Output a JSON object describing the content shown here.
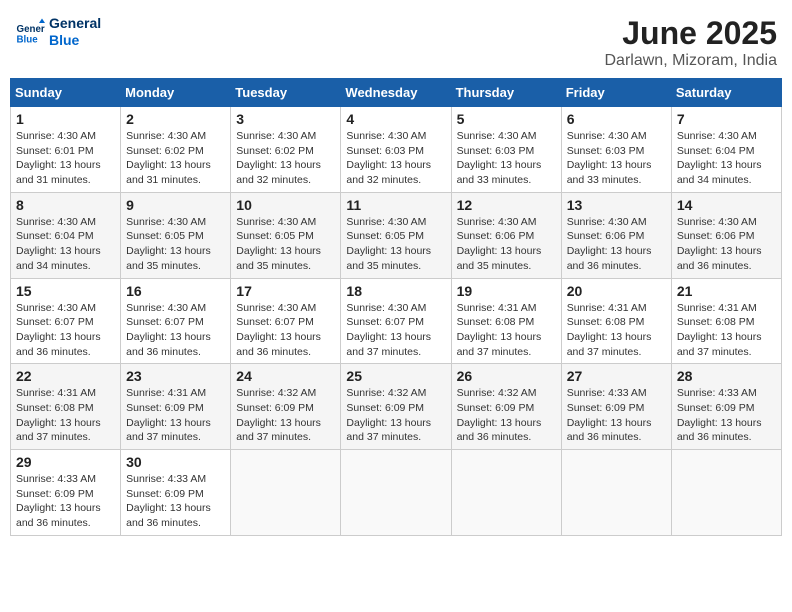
{
  "header": {
    "logo_line1": "General",
    "logo_line2": "Blue",
    "month_year": "June 2025",
    "location": "Darlawn, Mizoram, India"
  },
  "days_of_week": [
    "Sunday",
    "Monday",
    "Tuesday",
    "Wednesday",
    "Thursday",
    "Friday",
    "Saturday"
  ],
  "weeks": [
    [
      {
        "num": "1",
        "sunrise": "4:30 AM",
        "sunset": "6:01 PM",
        "daylight": "13 hours and 31 minutes."
      },
      {
        "num": "2",
        "sunrise": "4:30 AM",
        "sunset": "6:02 PM",
        "daylight": "13 hours and 31 minutes."
      },
      {
        "num": "3",
        "sunrise": "4:30 AM",
        "sunset": "6:02 PM",
        "daylight": "13 hours and 32 minutes."
      },
      {
        "num": "4",
        "sunrise": "4:30 AM",
        "sunset": "6:03 PM",
        "daylight": "13 hours and 32 minutes."
      },
      {
        "num": "5",
        "sunrise": "4:30 AM",
        "sunset": "6:03 PM",
        "daylight": "13 hours and 33 minutes."
      },
      {
        "num": "6",
        "sunrise": "4:30 AM",
        "sunset": "6:03 PM",
        "daylight": "13 hours and 33 minutes."
      },
      {
        "num": "7",
        "sunrise": "4:30 AM",
        "sunset": "6:04 PM",
        "daylight": "13 hours and 34 minutes."
      }
    ],
    [
      {
        "num": "8",
        "sunrise": "4:30 AM",
        "sunset": "6:04 PM",
        "daylight": "13 hours and 34 minutes."
      },
      {
        "num": "9",
        "sunrise": "4:30 AM",
        "sunset": "6:05 PM",
        "daylight": "13 hours and 35 minutes."
      },
      {
        "num": "10",
        "sunrise": "4:30 AM",
        "sunset": "6:05 PM",
        "daylight": "13 hours and 35 minutes."
      },
      {
        "num": "11",
        "sunrise": "4:30 AM",
        "sunset": "6:05 PM",
        "daylight": "13 hours and 35 minutes."
      },
      {
        "num": "12",
        "sunrise": "4:30 AM",
        "sunset": "6:06 PM",
        "daylight": "13 hours and 35 minutes."
      },
      {
        "num": "13",
        "sunrise": "4:30 AM",
        "sunset": "6:06 PM",
        "daylight": "13 hours and 36 minutes."
      },
      {
        "num": "14",
        "sunrise": "4:30 AM",
        "sunset": "6:06 PM",
        "daylight": "13 hours and 36 minutes."
      }
    ],
    [
      {
        "num": "15",
        "sunrise": "4:30 AM",
        "sunset": "6:07 PM",
        "daylight": "13 hours and 36 minutes."
      },
      {
        "num": "16",
        "sunrise": "4:30 AM",
        "sunset": "6:07 PM",
        "daylight": "13 hours and 36 minutes."
      },
      {
        "num": "17",
        "sunrise": "4:30 AM",
        "sunset": "6:07 PM",
        "daylight": "13 hours and 36 minutes."
      },
      {
        "num": "18",
        "sunrise": "4:30 AM",
        "sunset": "6:07 PM",
        "daylight": "13 hours and 37 minutes."
      },
      {
        "num": "19",
        "sunrise": "4:31 AM",
        "sunset": "6:08 PM",
        "daylight": "13 hours and 37 minutes."
      },
      {
        "num": "20",
        "sunrise": "4:31 AM",
        "sunset": "6:08 PM",
        "daylight": "13 hours and 37 minutes."
      },
      {
        "num": "21",
        "sunrise": "4:31 AM",
        "sunset": "6:08 PM",
        "daylight": "13 hours and 37 minutes."
      }
    ],
    [
      {
        "num": "22",
        "sunrise": "4:31 AM",
        "sunset": "6:08 PM",
        "daylight": "13 hours and 37 minutes."
      },
      {
        "num": "23",
        "sunrise": "4:31 AM",
        "sunset": "6:09 PM",
        "daylight": "13 hours and 37 minutes."
      },
      {
        "num": "24",
        "sunrise": "4:32 AM",
        "sunset": "6:09 PM",
        "daylight": "13 hours and 37 minutes."
      },
      {
        "num": "25",
        "sunrise": "4:32 AM",
        "sunset": "6:09 PM",
        "daylight": "13 hours and 37 minutes."
      },
      {
        "num": "26",
        "sunrise": "4:32 AM",
        "sunset": "6:09 PM",
        "daylight": "13 hours and 36 minutes."
      },
      {
        "num": "27",
        "sunrise": "4:33 AM",
        "sunset": "6:09 PM",
        "daylight": "13 hours and 36 minutes."
      },
      {
        "num": "28",
        "sunrise": "4:33 AM",
        "sunset": "6:09 PM",
        "daylight": "13 hours and 36 minutes."
      }
    ],
    [
      {
        "num": "29",
        "sunrise": "4:33 AM",
        "sunset": "6:09 PM",
        "daylight": "13 hours and 36 minutes."
      },
      {
        "num": "30",
        "sunrise": "4:33 AM",
        "sunset": "6:09 PM",
        "daylight": "13 hours and 36 minutes."
      },
      null,
      null,
      null,
      null,
      null
    ]
  ],
  "labels": {
    "sunrise": "Sunrise:",
    "sunset": "Sunset:",
    "daylight": "Daylight:"
  }
}
